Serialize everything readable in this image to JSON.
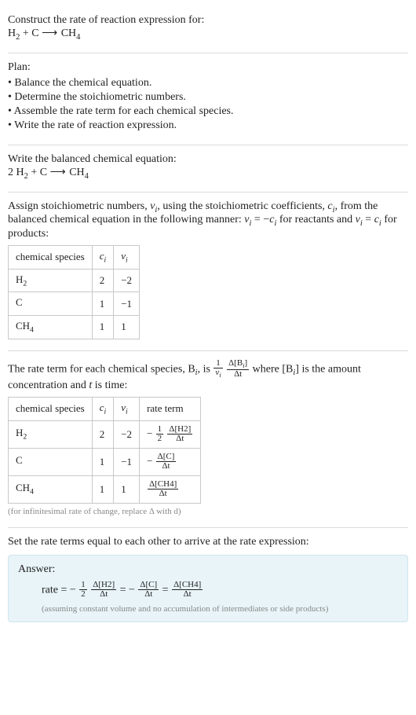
{
  "prompt": {
    "line1": "Construct the rate of reaction expression for:",
    "equation_h2": "H",
    "equation_h2_sub": "2",
    "equation_plus": " + C ",
    "equation_arrow": "⟶",
    "equation_ch4": " CH",
    "equation_ch4_sub": "4"
  },
  "plan": {
    "title": "Plan:",
    "b1": "• Balance the chemical equation.",
    "b2": "• Determine the stoichiometric numbers.",
    "b3": "• Assemble the rate term for each chemical species.",
    "b4": "• Write the rate of reaction expression."
  },
  "balanced": {
    "title": "Write the balanced chemical equation:",
    "coef": "2 H",
    "h2_sub": "2",
    "plus": " + C ",
    "arrow": "⟶",
    "ch4": " CH",
    "ch4_sub": "4"
  },
  "assign": {
    "text_a": "Assign stoichiometric numbers, ",
    "nu_i": "ν",
    "sub_i": "i",
    "text_b": ", using the stoichiometric coefficients, ",
    "c_i": "c",
    "text_c": ", from the balanced chemical equation in the following manner: ",
    "rel1a": "ν",
    "rel1b": " = −",
    "rel1c": "c",
    "text_d": " for reactants and ",
    "rel2a": "ν",
    "rel2b": " = ",
    "rel2c": "c",
    "text_e": " for products:",
    "headers": {
      "species": "chemical species",
      "c": "c",
      "nu": "ν",
      "i": "i"
    },
    "rows": [
      {
        "species_a": "H",
        "species_sub": "2",
        "c": "2",
        "nu": "−2"
      },
      {
        "species_a": "C",
        "species_sub": "",
        "c": "1",
        "nu": "−1"
      },
      {
        "species_a": "CH",
        "species_sub": "4",
        "c": "1",
        "nu": "1"
      }
    ]
  },
  "rateterm": {
    "text_a": "The rate term for each chemical species, B",
    "sub_i": "i",
    "text_b": ", is ",
    "one": "1",
    "nu": "ν",
    "dconc_num": "Δ[B",
    "dconc_num_close": "]",
    "dconc_den": "Δt",
    "text_c": " where [B",
    "text_d": "] is the amount concentration and ",
    "t": "t",
    "text_e": " is time:",
    "headers": {
      "species": "chemical species",
      "c": "c",
      "nu": "ν",
      "rate": "rate term",
      "i": "i"
    },
    "rows": [
      {
        "species_a": "H",
        "species_sub": "2",
        "c": "2",
        "nu": "−2",
        "rt_prefix": "−",
        "rt_coef_num": "1",
        "rt_coef_den": "2",
        "rt_num": "Δ[H2]",
        "rt_den": "Δt"
      },
      {
        "species_a": "C",
        "species_sub": "",
        "c": "1",
        "nu": "−1",
        "rt_prefix": "−",
        "rt_coef_num": "",
        "rt_coef_den": "",
        "rt_num": "Δ[C]",
        "rt_den": "Δt"
      },
      {
        "species_a": "CH",
        "species_sub": "4",
        "c": "1",
        "nu": "1",
        "rt_prefix": "",
        "rt_coef_num": "",
        "rt_coef_den": "",
        "rt_num": "Δ[CH4]",
        "rt_den": "Δt"
      }
    ],
    "note": "(for infinitesimal rate of change, replace Δ with d)"
  },
  "final": {
    "title": "Set the rate terms equal to each other to arrive at the rate expression:",
    "answer_label": "Answer:",
    "rate_eq": "rate = −",
    "half_num": "1",
    "half_den": "2",
    "t1_num": "Δ[H2]",
    "t1_den": "Δt",
    "eq": " = −",
    "t2_num": "Δ[C]",
    "t2_den": "Δt",
    "eq2": " = ",
    "t3_num": "Δ[CH4]",
    "t3_den": "Δt",
    "assumption": "(assuming constant volume and no accumulation of intermediates or side products)"
  }
}
